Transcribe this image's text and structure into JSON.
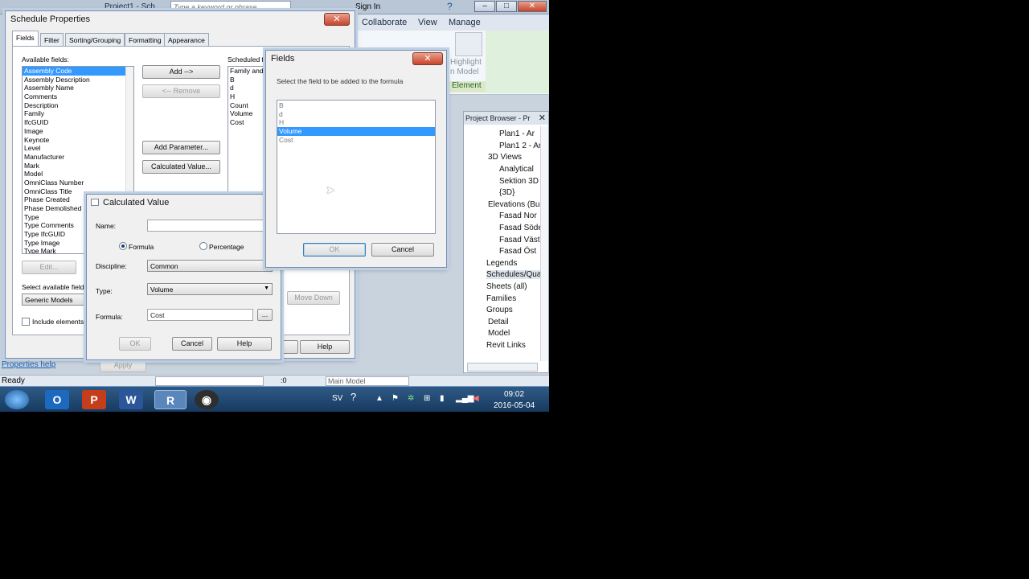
{
  "app": {
    "title": "Project1 - Sch",
    "search_placeholder": "Type a keyword or phrase",
    "sign_in": "Sign In",
    "ribbon_tabs": [
      "Collaborate",
      "View",
      "Manage"
    ],
    "ribbon_highlight": "Highlight",
    "ribbon_in_model": "n Model",
    "ribbon_panel": "Element"
  },
  "schedule_properties": {
    "title": "Schedule Properties",
    "tabs": [
      "Fields",
      "Filter",
      "Sorting/Grouping",
      "Formatting",
      "Appearance"
    ],
    "available_label": "Available fields:",
    "available_fields": [
      "Assembly Code",
      "Assembly Description",
      "Assembly Name",
      "Comments",
      "Description",
      "Family",
      "IfcGUID",
      "Image",
      "Keynote",
      "Level",
      "Manufacturer",
      "Mark",
      "Model",
      "OmniClass Number",
      "OmniClass Title",
      "Phase Created",
      "Phase Demolished",
      "Type",
      "Type Comments",
      "Type IfcGUID",
      "Type Image",
      "Type Mark"
    ],
    "add_button": "Add -->",
    "remove_button": "<-- Remove",
    "add_parameter_button": "Add Parameter...",
    "calculated_value_button": "Calculated Value...",
    "scheduled_label": "Scheduled f",
    "scheduled_fields": [
      "Family and",
      "B",
      "d",
      "H",
      "Count",
      "Volume",
      "Cost"
    ],
    "edit_button": "Edit...",
    "select_available_label": "Select available field",
    "select_available_value": "Generic Models",
    "include_elements_label": "Include elements",
    "move_down_button": "Move Down",
    "help_button": "Help",
    "properties_help": "Properties help",
    "apply_button": "Apply"
  },
  "calculated_value": {
    "title": "Calculated Value",
    "name_label": "Name:",
    "name_value": "",
    "formula_radio": "Formula",
    "percentage_radio": "Percentage",
    "discipline_label": "Discipline:",
    "discipline_value": "Common",
    "type_label": "Type:",
    "type_value": "Volume",
    "formula_label": "Formula:",
    "formula_value": "Cost",
    "ellipsis_button": "...",
    "ok_button": "OK",
    "cancel_button": "Cancel",
    "help_button": "Help"
  },
  "fields_dialog": {
    "title": "Fields",
    "instruction": "Select the field to be added to the formula",
    "items": [
      "B",
      "d",
      "H",
      "Volume",
      "Cost"
    ],
    "selected_index": 3,
    "ok_button": "OK",
    "cancel_button": "Cancel"
  },
  "project_browser": {
    "title": "Project Browser - Pr",
    "items": [
      {
        "label": "Plan1 - Ar"
      },
      {
        "label": "Plan1 2 - Ar"
      },
      {
        "label": "3D Views"
      },
      {
        "label": "Analytical"
      },
      {
        "label": "Sektion 3D"
      },
      {
        "label": "{3D}"
      },
      {
        "label": "Elevations (Bu"
      },
      {
        "label": "Fasad Nor"
      },
      {
        "label": "Fasad Söde"
      },
      {
        "label": "Fasad Väst"
      },
      {
        "label": "Fasad Öst"
      },
      {
        "label": "Legends"
      },
      {
        "label": "Schedules/Qua"
      },
      {
        "label": "Sheets (all)"
      },
      {
        "label": "Families"
      },
      {
        "label": "Groups"
      },
      {
        "label": "Detail"
      },
      {
        "label": "Model"
      },
      {
        "label": "Revit Links"
      }
    ]
  },
  "status": {
    "ready": "Ready",
    "coord": ":0",
    "model": "Main Model"
  },
  "taskbar": {
    "lang": "SV",
    "time": "09:02",
    "date": "2016-05-04"
  },
  "colors": {
    "selection": "#3399ff",
    "taskbar": "#1f4670",
    "ribbon_green": "#1f8a3c"
  }
}
